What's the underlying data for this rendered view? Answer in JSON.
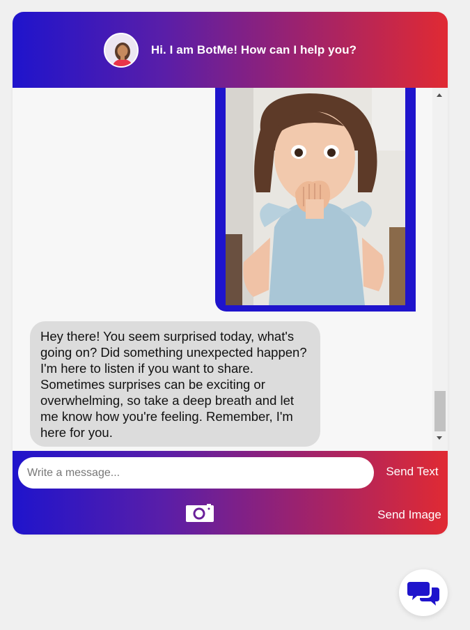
{
  "header": {
    "title": "Hi. I am BotMe! How can I help you?",
    "avatar_icon": "woman-avatar-icon"
  },
  "messages": [
    {
      "sender": "user",
      "kind": "image",
      "image_description": "surprised-girl-photo"
    },
    {
      "sender": "bot",
      "kind": "text",
      "text": "Hey there! You seem surprised today, what's going on? Did something unexpected happen? I'm here to listen if you want to share. Sometimes surprises can be exciting or overwhelming, so take a deep breath and let me know how you're feeling. Remember, I'm here for you."
    }
  ],
  "composer": {
    "placeholder": "Write a message...",
    "value": "",
    "send_text_label": "Send Text",
    "send_image_label": "Send Image",
    "camera_icon": "camera-icon"
  },
  "launcher": {
    "icon": "chat-bubbles-icon"
  },
  "colors": {
    "gradient_start": "#1f14cc",
    "gradient_end": "#e02a33",
    "bot_bubble": "#dcdcdc",
    "user_image_border": "#1f14cc",
    "launcher_icon": "#1f14cc"
  }
}
